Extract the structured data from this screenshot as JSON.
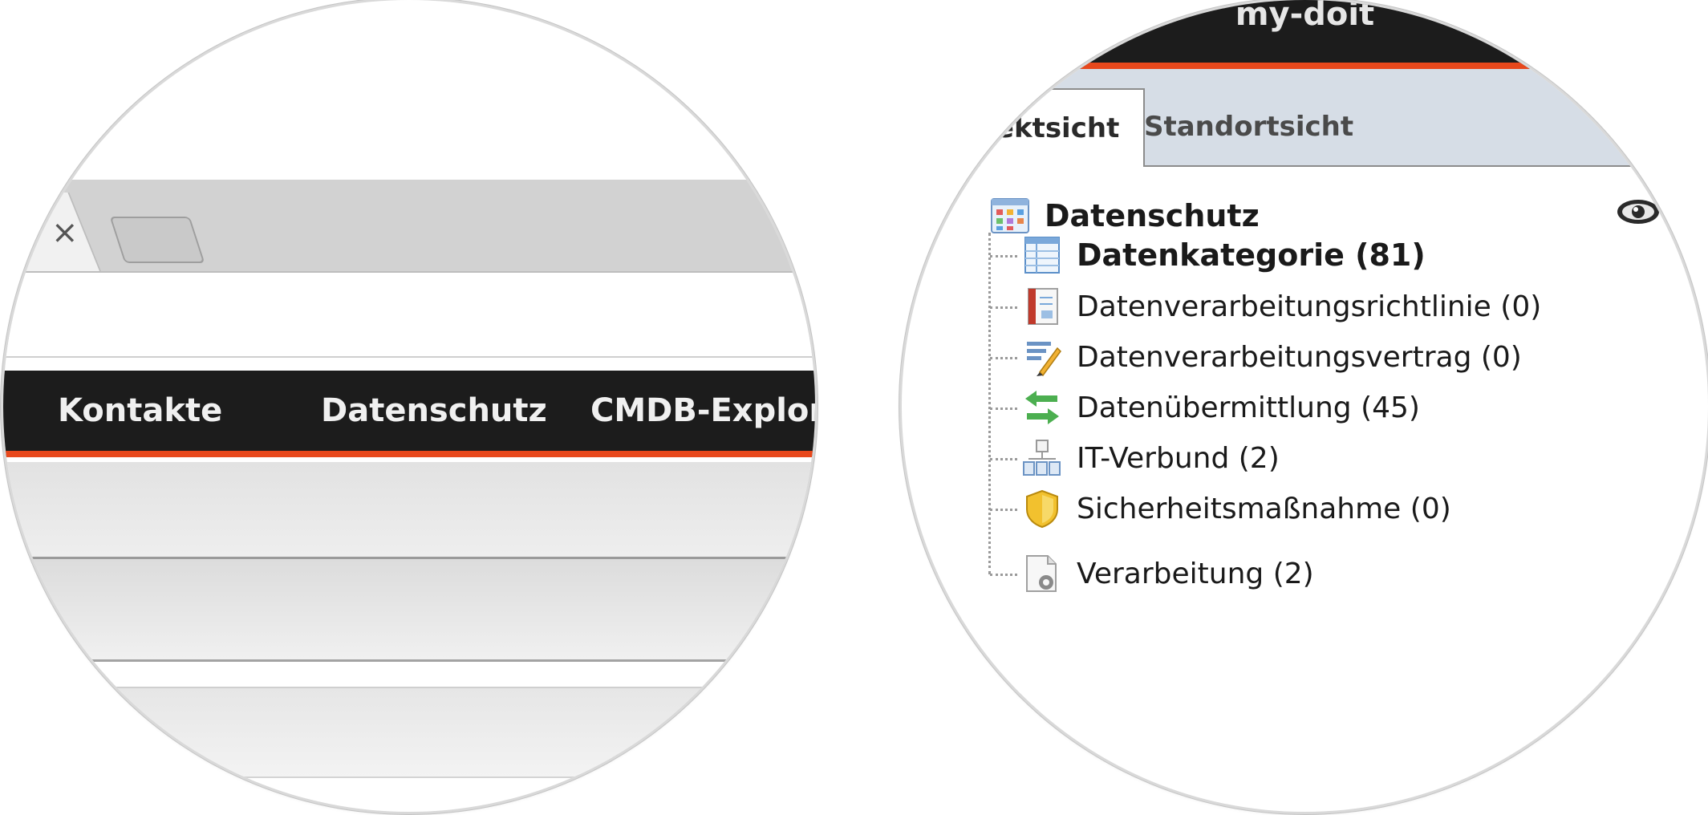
{
  "left_zoom": {
    "browser": {
      "tab_close_glyph": "×"
    },
    "navbar": {
      "items": [
        {
          "label": "Kontakte"
        },
        {
          "label": "Datenschutz"
        },
        {
          "label": "CMDB-Explorer"
        }
      ],
      "accent_color": "#e8481c"
    }
  },
  "right_zoom": {
    "header": {
      "brand": "my-doit"
    },
    "tabs": [
      {
        "label": "Objektsicht",
        "active": true
      },
      {
        "label": "Standortsicht",
        "active": false
      }
    ],
    "tree": {
      "root": {
        "label": "Datenschutz",
        "icon": "grid-table-icon"
      },
      "visibility_icon": "eye-icon",
      "children": [
        {
          "label": "Datenkategorie (81)",
          "icon": "spreadsheet-icon",
          "bold": true
        },
        {
          "label": "Datenverarbeitungsrichtlinie (0)",
          "icon": "notebook-icon",
          "bold": false
        },
        {
          "label": "Datenverarbeitungsvertrag (0)",
          "icon": "signature-pen-icon",
          "bold": false
        },
        {
          "label": "Datenübermittlung (45)",
          "icon": "transfer-arrows-icon",
          "bold": false
        },
        {
          "label": "IT-Verbund (2)",
          "icon": "network-group-icon",
          "bold": false
        },
        {
          "label": "Sicherheitsmaßnahme (0)",
          "icon": "shield-icon",
          "bold": false
        },
        {
          "label": "Verarbeitung (2)",
          "icon": "document-gear-icon",
          "bold": false
        }
      ]
    }
  }
}
